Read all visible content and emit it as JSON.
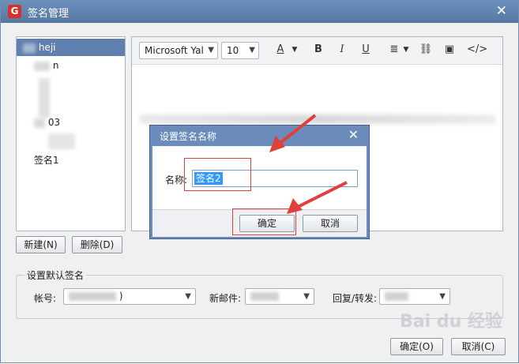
{
  "window": {
    "title": "签名管理",
    "close_glyph": "✕"
  },
  "signature_list": {
    "items": [
      {
        "label": "heji",
        "selected": true
      },
      {
        "label": "n",
        "selected": false
      },
      {
        "label": "03",
        "selected": false
      },
      {
        "label": "签名1",
        "selected": false
      }
    ]
  },
  "editor": {
    "font_family": "Microsoft Yal",
    "font_size": "10",
    "toolbar": {
      "font_color": "A",
      "bold": "B",
      "italic": "I",
      "underline": "U",
      "align": "≣",
      "link": "⛓",
      "image": "▣",
      "source": "</>"
    }
  },
  "buttons": {
    "new": "新建(N)",
    "delete": "删除(D)",
    "ok": "确定(O)",
    "cancel": "取消(C)"
  },
  "defaults": {
    "group_title": "设置默认签名",
    "account_label": "帐号:",
    "account_value": ")",
    "new_mail_label": "新邮件:",
    "reply_label": "回复/转发:"
  },
  "dialog": {
    "title": "设置签名名称",
    "name_label": "名称:",
    "name_value": "签名2",
    "ok": "确定",
    "cancel": "取消"
  },
  "colors": {
    "titlebar": "#5f82b0",
    "selection": "#5f7fae",
    "annotation": "#e0403a"
  },
  "watermark": "Bai du 经验"
}
